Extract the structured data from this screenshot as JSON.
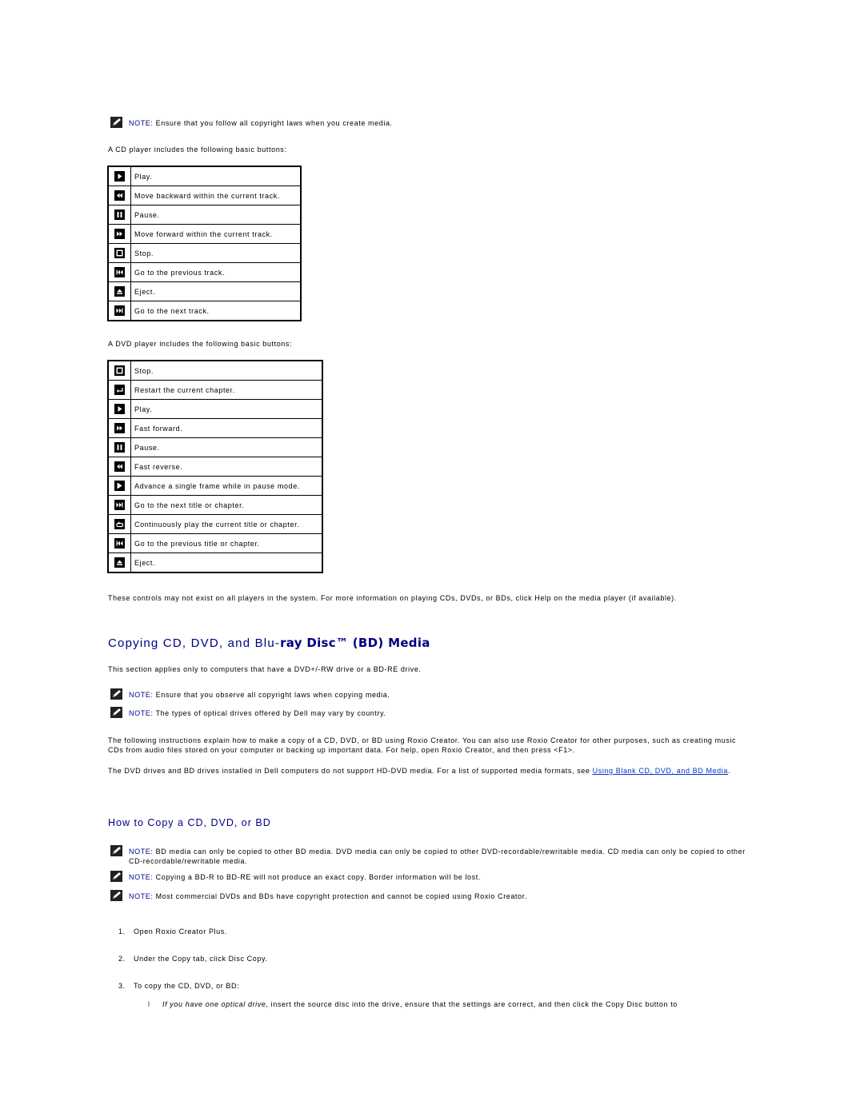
{
  "notes_top": {
    "label": "NOTE:",
    "text": " Ensure that you follow all copyright laws when you create media."
  },
  "cd_intro": "A CD player includes the following basic buttons:",
  "cd_buttons": [
    {
      "icon": "play-icon",
      "label": "Play."
    },
    {
      "icon": "rewind-icon",
      "label": "Move backward within the current track."
    },
    {
      "icon": "pause-icon",
      "label": "Pause."
    },
    {
      "icon": "fast-forward-icon",
      "label": "Move forward within the current track."
    },
    {
      "icon": "stop-icon",
      "label": "Stop."
    },
    {
      "icon": "previous-track-icon",
      "label": "Go to the previous track."
    },
    {
      "icon": "eject-icon",
      "label": "Eject."
    },
    {
      "icon": "next-track-icon",
      "label": "Go to the next track."
    }
  ],
  "dvd_intro": "A DVD player includes the following basic buttons:",
  "dvd_buttons": [
    {
      "icon": "stop-icon",
      "label": "Stop."
    },
    {
      "icon": "restart-chapter-icon",
      "label": "Restart the current chapter."
    },
    {
      "icon": "play-icon",
      "label": "Play."
    },
    {
      "icon": "fast-forward-icon",
      "label": "Fast forward."
    },
    {
      "icon": "pause-icon",
      "label": "Pause."
    },
    {
      "icon": "rewind-icon",
      "label": "Fast reverse."
    },
    {
      "icon": "frame-advance-icon",
      "label": "Advance a single frame while in pause mode."
    },
    {
      "icon": "next-track-icon",
      "label": "Go to the next title or chapter."
    },
    {
      "icon": "repeat-icon",
      "label": "Continuously play the current title or chapter."
    },
    {
      "icon": "previous-track-icon",
      "label": "Go to the previous title or chapter."
    },
    {
      "icon": "eject-icon",
      "label": "Eject."
    }
  ],
  "controls_note": "These controls may not exist on all players in the system. For more information on playing CDs, DVDs, or BDs, click Help on the media player (if available).",
  "section": {
    "title_plain": "Copying CD, DVD, and Blu-",
    "title_bold": "ray Disc™ (BD) Media",
    "applies": "This section applies only to computers that have a DVD+/-RW drive or a BD-RE drive.",
    "notes": [
      {
        "label": "NOTE:",
        "text": " Ensure that you observe all copyright laws when copying media."
      },
      {
        "label": "NOTE:",
        "text": " The types of optical drives offered by Dell may vary by country."
      }
    ],
    "instructions": "The following instructions explain how to make a copy of a CD, DVD, or BD using Roxio Creator. You can also use Roxio Creator for other purposes, such as creating music CDs from audio files stored on your computer or backing up important data. For help, open Roxio Creator, and then press <F1>.",
    "hd_dvd_text": "The DVD drives and BD drives installed in Dell computers do not support HD-DVD media. For a list of supported media formats, see ",
    "hd_dvd_link": "Using Blank CD, DVD, and BD Media",
    "hd_dvd_end": "."
  },
  "howto": {
    "title": "How to Copy a CD, DVD, or BD",
    "notes": [
      {
        "label": "NOTE:",
        "text": " BD media can only be copied to other BD media. DVD media can only be copied to other DVD-recordable/rewritable media. CD media can only be copied to other CD-recordable/rewritable media."
      },
      {
        "label": "NOTE:",
        "text": " Copying a BD-R to BD-RE will not produce an exact copy. Border information will be lost."
      },
      {
        "label": "NOTE:",
        "text": " Most commercial DVDs and BDs have copyright protection and cannot be copied using Roxio Creator."
      }
    ],
    "steps": [
      {
        "num": "1.",
        "text": "Open Roxio Creator Plus."
      },
      {
        "num": "2.",
        "text": "Under the Copy tab, click Disc Copy."
      },
      {
        "num": "3.",
        "text": "To copy the CD, DVD, or BD:"
      }
    ],
    "bullet": {
      "marker": "l",
      "italic": "If you have one optical drive",
      "text": ", insert the source disc into the drive, ensure that the settings are correct, and then click the Copy Disc button to"
    }
  }
}
